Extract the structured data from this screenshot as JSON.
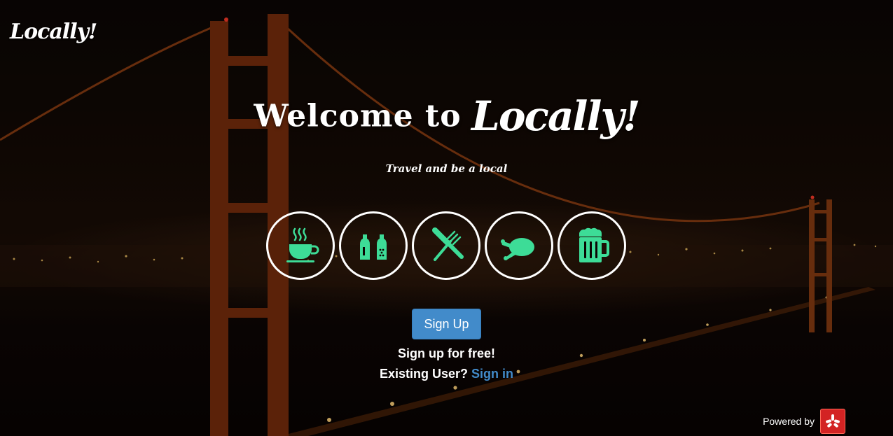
{
  "brand": {
    "logo_text": "Locally!"
  },
  "hero": {
    "title_part1": "Welcome to",
    "title_part2": "Locally!",
    "tagline": "Travel and be a local",
    "categories": [
      {
        "icon": "coffee-cup-icon"
      },
      {
        "icon": "salt-pepper-shakers-icon"
      },
      {
        "icon": "fork-knife-icon"
      },
      {
        "icon": "roast-chicken-icon"
      },
      {
        "icon": "beer-mug-icon"
      }
    ],
    "signup_button_label": "Sign Up",
    "signup_free_text": "Sign up for free!",
    "existing_user_text": "Existing User?",
    "signin_link_label": "Sign in"
  },
  "footer": {
    "powered_by_text": "Powered by",
    "provider_logo": "yelp-logo-icon"
  },
  "colors": {
    "icon_green": "#3ddc97",
    "button_blue": "#428bca",
    "link_blue": "#428bca",
    "yelp_red": "#d32323"
  }
}
